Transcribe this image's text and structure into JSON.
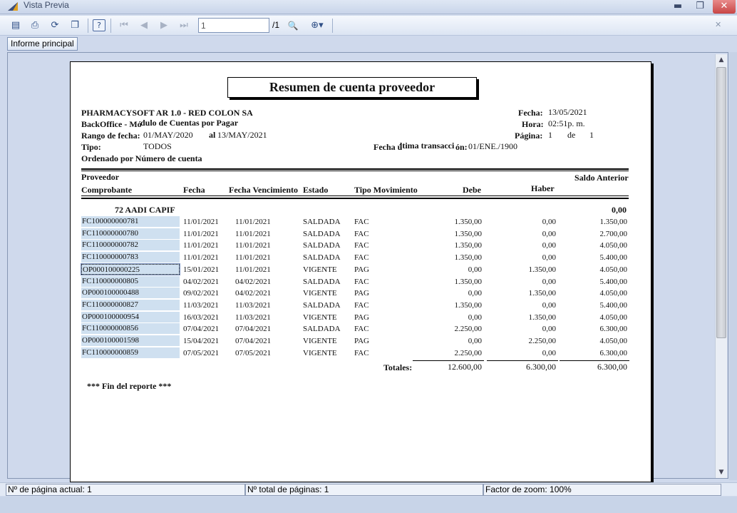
{
  "window": {
    "title": "Vista Previa",
    "min_glyph": "▬",
    "max_glyph": "❐",
    "close_glyph": "✕"
  },
  "toolbar": {
    "icons": {
      "setup": "▤",
      "print": "⎙",
      "refresh": "⟳",
      "copy": "❐",
      "help": "?",
      "first": "⏮",
      "prev": "◀",
      "next": "▶",
      "last": "⏭",
      "find": "🔍",
      "zoom": "⊕▾",
      "close": "✕"
    },
    "page_value": "1",
    "page_total": "/1"
  },
  "tab": {
    "label": "Informe principal"
  },
  "report": {
    "title": "Resumen de cuenta proveedor",
    "company": "PHARMACYSOFT AR 1.0 - RED COLON SA",
    "module_a": "BackOffice  - Mó",
    "module_b": "dulo de Cuentas por Pagar",
    "range_label": "Rango de fecha:",
    "range_from": "01/MAY/2020",
    "range_al": "al",
    "range_to": "13/MAY/2021",
    "tipo_label": "Tipo:",
    "tipo_value": "TODOS",
    "ordered": "Ordenado por Número de cuenta",
    "fecha_label": "Fecha:",
    "fecha_value": "13/05/2021",
    "hora_label": "Hora:",
    "hora_value": "02:51p. m.",
    "pagina_label": "Página:",
    "pagina_value": "1",
    "pagina_de": "de",
    "pagina_total": "1",
    "last_tx_a": "Fecha ú",
    "last_tx_b": "ltima transacci",
    "last_tx_c": "ón:",
    "last_tx_value": "01/ENE./1900",
    "columns": {
      "proveedor": "Proveedor",
      "saldo_anterior": "Saldo Anterior",
      "comprobante": "Comprobante",
      "fecha": "Fecha",
      "vencimiento": "Fecha Vencimiento",
      "estado": "Estado",
      "tipo_mov": "Tipo Movimiento",
      "debe": "Debe",
      "haber": "Haber"
    },
    "group_name": "72  AADI CAPIF",
    "group_saldo": "0,00",
    "rows": [
      [
        "FC100000000781",
        "11/01/2021",
        "11/01/2021",
        "SALDADA",
        "FAC",
        "1.350,00",
        "0,00",
        "1.350,00"
      ],
      [
        "FC110000000780",
        "11/01/2021",
        "11/01/2021",
        "SALDADA",
        "FAC",
        "1.350,00",
        "0,00",
        "2.700,00"
      ],
      [
        "FC110000000782",
        "11/01/2021",
        "11/01/2021",
        "SALDADA",
        "FAC",
        "1.350,00",
        "0,00",
        "4.050,00"
      ],
      [
        "FC110000000783",
        "11/01/2021",
        "11/01/2021",
        "SALDADA",
        "FAC",
        "1.350,00",
        "0,00",
        "5.400,00"
      ],
      [
        "OP000100000225",
        "15/01/2021",
        "11/01/2021",
        "VIGENTE",
        "PAG",
        "0,00",
        "1.350,00",
        "4.050,00"
      ],
      [
        "FC110000000805",
        "04/02/2021",
        "04/02/2021",
        "SALDADA",
        "FAC",
        "1.350,00",
        "0,00",
        "5.400,00"
      ],
      [
        "OP000100000488",
        "09/02/2021",
        "04/02/2021",
        "VIGENTE",
        "PAG",
        "0,00",
        "1.350,00",
        "4.050,00"
      ],
      [
        "FC110000000827",
        "11/03/2021",
        "11/03/2021",
        "SALDADA",
        "FAC",
        "1.350,00",
        "0,00",
        "5.400,00"
      ],
      [
        "OP000100000954",
        "16/03/2021",
        "11/03/2021",
        "VIGENTE",
        "PAG",
        "0,00",
        "1.350,00",
        "4.050,00"
      ],
      [
        "FC110000000856",
        "07/04/2021",
        "07/04/2021",
        "SALDADA",
        "FAC",
        "2.250,00",
        "0,00",
        "6.300,00"
      ],
      [
        "OP000100001598",
        "15/04/2021",
        "07/04/2021",
        "VIGENTE",
        "PAG",
        "0,00",
        "2.250,00",
        "4.050,00"
      ],
      [
        "FC110000000859",
        "07/05/2021",
        "07/05/2021",
        "VIGENTE",
        "FAC",
        "2.250,00",
        "0,00",
        "6.300,00"
      ]
    ],
    "totals_label": "Totales:",
    "total_debe": "12.600,00",
    "total_haber": "6.300,00",
    "total_saldo": "6.300,00",
    "end": "***  Fin del reporte ***"
  },
  "status": {
    "current_page": "Nº de página actual: 1",
    "total_pages": "Nº total de páginas: 1",
    "zoom": "Factor de zoom: 100%"
  }
}
